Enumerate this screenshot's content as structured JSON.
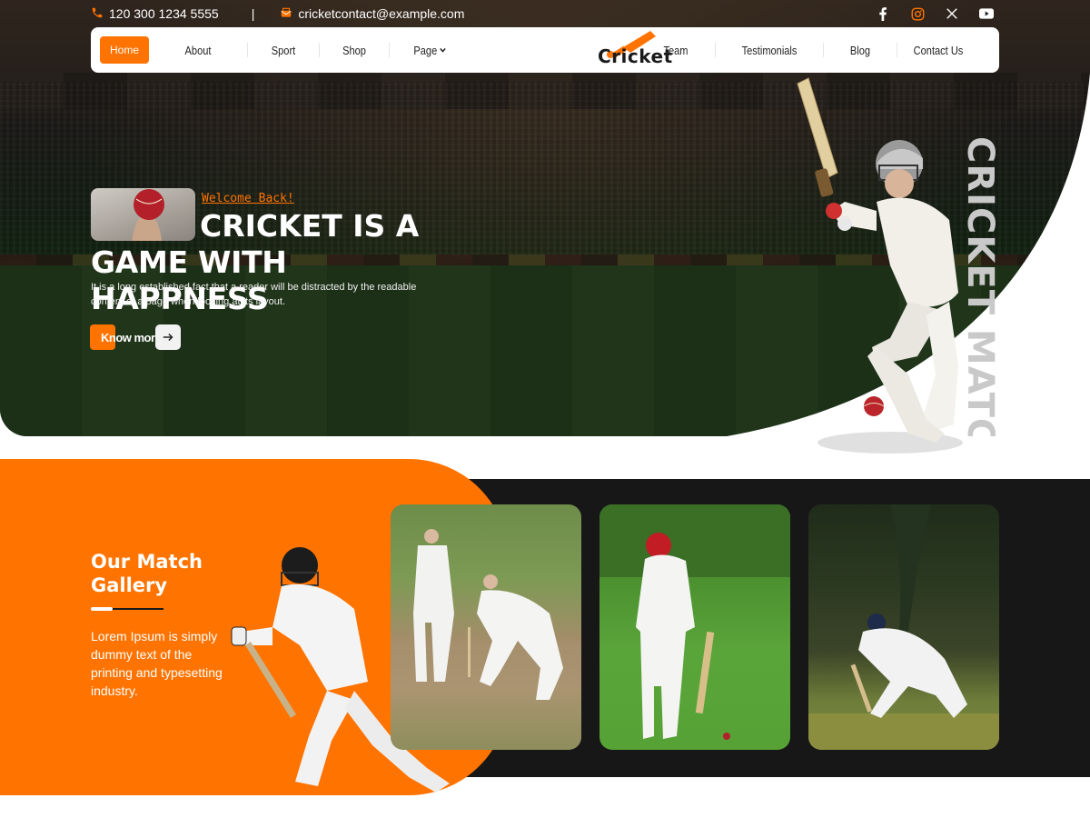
{
  "topbar": {
    "phone": "120 300 1234 5555",
    "separator": "|",
    "email": "cricketcontact@example.com",
    "socials": [
      "facebook-icon",
      "instagram-icon",
      "x-icon",
      "youtube-icon"
    ]
  },
  "nav": {
    "left": [
      "Home",
      "About",
      "Sport",
      "Shop",
      "Page"
    ],
    "right": [
      "Team",
      "Testimonials",
      "Blog",
      "Contact Us"
    ],
    "logo": "Cricket"
  },
  "hero": {
    "welcome": "Welcome Back!",
    "title_line1": "CRICKET IS A",
    "title_line2": "GAME WITH HAPPNESS",
    "description": "It is a long established fact that a reader will be distracted by the readable content of a page when looking at its layout.",
    "button": "Know more",
    "vertical_text": "CRICKET MATCH"
  },
  "gallery": {
    "title": "Our Match Gallery",
    "description": "Lorem Ipsum is simply dummy text of the printing and typesetting industry."
  },
  "colors": {
    "accent": "#ff7300",
    "dark": "#171717"
  }
}
